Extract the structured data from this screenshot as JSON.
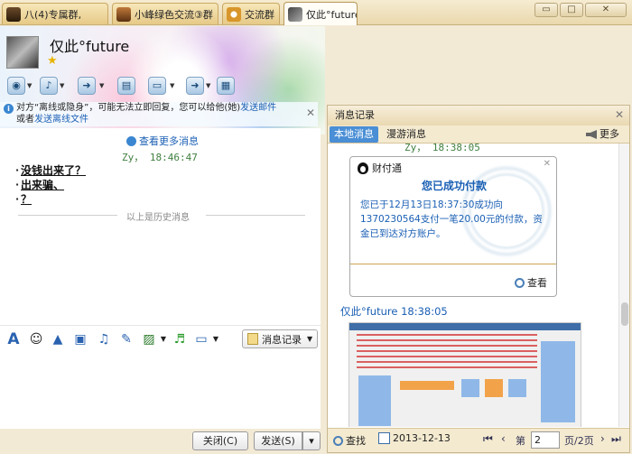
{
  "tabs": [
    {
      "label": "八(4)专属群,"
    },
    {
      "label": "小峰绿色交流③群"
    },
    {
      "label": "交流群"
    },
    {
      "label": "仅此°future"
    }
  ],
  "window_controls": {
    "minimize": "▭",
    "maximize": "□",
    "close": "✕"
  },
  "header": {
    "contact_name": "仅此°future"
  },
  "notice": {
    "text1": "对方“离线或隐身”，可能无法立即回复，您可以给他(她)",
    "link1": "发送邮件",
    "text2": "或者",
    "link2": "发送离线文件"
  },
  "chat": {
    "more_messages": "查看更多消息",
    "sender_time": "Zy，   18:46:47",
    "messages": [
      "没钱出来了？",
      "出来骗、",
      "？"
    ],
    "history_divider": "以上是历史消息"
  },
  "input_toolbar": {
    "history_button": "消息记录"
  },
  "buttons": {
    "close": "关闭(C)",
    "send": "发送(S)",
    "send_dropdown": "▾"
  },
  "right_panel": {
    "title": "消息记录",
    "tabs": [
      "本地消息",
      "漫游消息"
    ],
    "more": "更多",
    "log_cut": "Zy，  18:38:05",
    "payment": {
      "brand": "财付通",
      "title": "您已成功付款",
      "body": "您已于12月13日18:37:30成功向1370230564支付一笔20.00元的付款，资金已到达对方账户。",
      "view": "查看"
    },
    "sender2": "仅此°future 18:38:05",
    "bottom": {
      "find": "查找",
      "date": "2013-12-13",
      "page_prefix": "第",
      "page_value": "2",
      "page_suffix": "页/2页"
    }
  }
}
